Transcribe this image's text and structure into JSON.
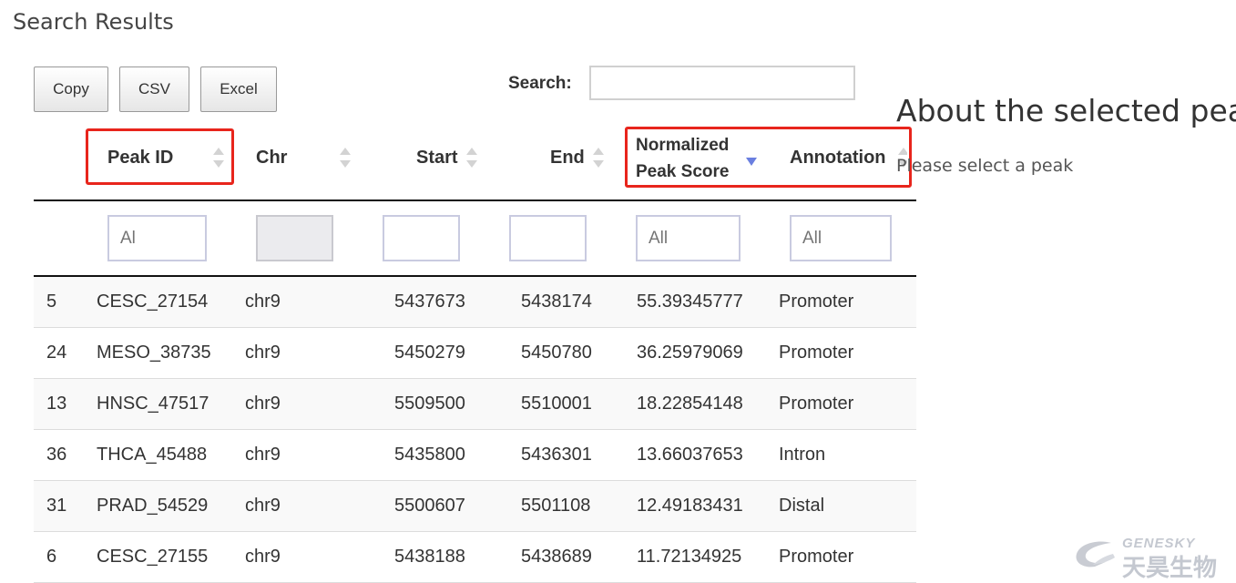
{
  "page": {
    "heading": "Search Results"
  },
  "toolbar": {
    "copy_label": "Copy",
    "csv_label": "CSV",
    "excel_label": "Excel",
    "search_label": "Search:",
    "search_value": ""
  },
  "table": {
    "columns": {
      "peak_id": "Peak ID",
      "chr": "Chr",
      "start": "Start",
      "end": "End",
      "score_line1": "Normalized",
      "score_line2": "Peak Score",
      "annotation": "Annotation"
    },
    "sorted_column": "Normalized Peak Score",
    "sort_direction": "descending",
    "filters": {
      "peak_id": "Al",
      "chr": "",
      "start": "",
      "end": "",
      "score": "All",
      "annotation": "All"
    },
    "rows": [
      {
        "index": "5",
        "peak_id": "CESC_27154",
        "chr": "chr9",
        "start": "5437673",
        "end": "5438174",
        "score": "55.39345777",
        "annotation": "Promoter"
      },
      {
        "index": "24",
        "peak_id": "MESO_38735",
        "chr": "chr9",
        "start": "5450279",
        "end": "5450780",
        "score": "36.25979069",
        "annotation": "Promoter"
      },
      {
        "index": "13",
        "peak_id": "HNSC_47517",
        "chr": "chr9",
        "start": "5509500",
        "end": "5510001",
        "score": "18.22854148",
        "annotation": "Promoter"
      },
      {
        "index": "36",
        "peak_id": "THCA_45488",
        "chr": "chr9",
        "start": "5435800",
        "end": "5436301",
        "score": "13.66037653",
        "annotation": "Intron"
      },
      {
        "index": "31",
        "peak_id": "PRAD_54529",
        "chr": "chr9",
        "start": "5500607",
        "end": "5501108",
        "score": "12.49183431",
        "annotation": "Distal"
      },
      {
        "index": "6",
        "peak_id": "CESC_27155",
        "chr": "chr9",
        "start": "5438188",
        "end": "5438689",
        "score": "11.72134925",
        "annotation": "Promoter"
      }
    ]
  },
  "about": {
    "title": "About the selected peak",
    "placeholder": "Please select a peak"
  },
  "watermark": {
    "brand_en": "GENESKY",
    "brand_cn": "天昊生物"
  },
  "colors": {
    "highlight": "#e8251c",
    "sort_active": "#6a7fe0"
  }
}
